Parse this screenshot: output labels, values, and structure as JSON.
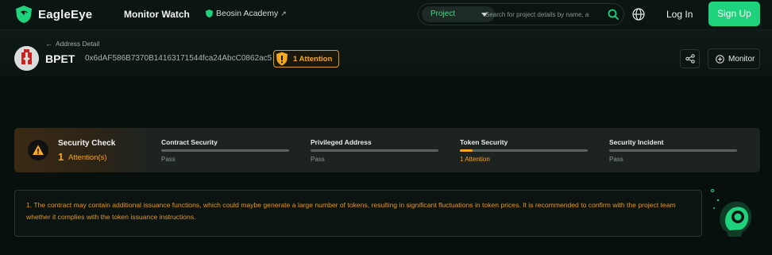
{
  "nav": {
    "brand": "EagleEye",
    "monitor_watch": "Monitor Watch",
    "academy": "Beosin Academy",
    "search": {
      "category": "Project",
      "placeholder": "Search for project details by name, a"
    },
    "login": "Log In",
    "signup": "Sign Up"
  },
  "header": {
    "back": "Address Detail",
    "token_name": "BPET",
    "address": "0x6dAF586B7370B14163171544fca24AbcC0862ac5",
    "attention": "1 Attention",
    "monitor": "Monitor"
  },
  "security": {
    "title": "Security Check",
    "count": "1",
    "count_label": "Attention(s)",
    "items": [
      {
        "name": "Contract Security",
        "status": "Pass",
        "level": 0
      },
      {
        "name": "Privileged Address",
        "status": "Pass",
        "level": 0
      },
      {
        "name": "Token Security",
        "status": "1 Attention",
        "level": 0.1
      },
      {
        "name": "Security Incident",
        "status": "Pass",
        "level": 0
      }
    ]
  },
  "message": "1. The contract may contain additional issuance functions, which could maybe generate a large number of tokens, resulting in significant fluctuations in token prices. It is recommended to confirm with the project team whether it complies with the token issuance instructions.",
  "colors": {
    "accent": "#1fd27c",
    "warning": "#f5a623",
    "background": "#07100d"
  }
}
